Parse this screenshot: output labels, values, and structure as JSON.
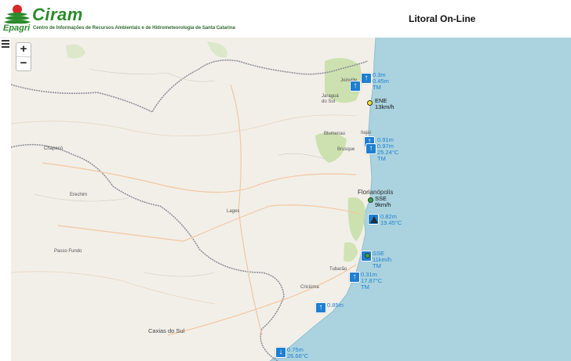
{
  "header": {
    "logo_agency": "Epagri",
    "logo_name": "Ciram",
    "logo_subtitle": "Centro de Informações de Recursos Ambientais e de Hidrometeorologia de Santa Catarina",
    "title": "Litoral On-Line"
  },
  "controls": {
    "menu_icon": "hamburger-icon",
    "zoom_in_label": "+",
    "zoom_out_label": "−"
  },
  "colors": {
    "sea": "#aad3df",
    "land": "#f2efe9",
    "forest": "#c8dfa8",
    "marker": "#1f7fd0"
  },
  "cities": {
    "joinville": "Joinville",
    "jaragua": "Jaraguá do Sul",
    "blumenau": "Blumenau",
    "itajai": "Itajaí",
    "brusque": "Brusque",
    "chapeco": "Chapecó",
    "florianopolis": "Florianópolis",
    "erechim": "Erechim",
    "lages": "Lages",
    "passo_fundo": "Passo Fundo",
    "tubarao": "Tubarão",
    "criciuma": "Criciúma",
    "caxias": "Caxias do Sul"
  },
  "stations": {
    "s1": {
      "l1": "0.3m",
      "l2": "0.45m",
      "l3": "TM",
      "icon": "arrow-up-icon"
    },
    "s2": {
      "l1": "ENE",
      "l2": "13km/h",
      "icon": "wind-dot-icon"
    },
    "s3": {
      "l1": "0.91m",
      "l2": "0.97m",
      "l3": "25.24°C",
      "l4": "TM",
      "icon": "arrow-up-icon"
    },
    "s4": {
      "l1": "SSE",
      "l2": "9km/h",
      "icon": "wind-dot-icon"
    },
    "s5": {
      "l1": "0.82m",
      "l2": "19.45°C",
      "icon": "triangle-icon"
    },
    "s6": {
      "l1": "SSE",
      "l2": "11km/h",
      "l3": "TM",
      "icon": "arrow-up-icon"
    },
    "s7": {
      "l1": "0.31m",
      "l2": "17.87°C",
      "l3": "TM",
      "icon": "arrow-up-icon"
    },
    "s8": {
      "l1": "0.85m",
      "icon": "arrow-up-icon"
    },
    "s9": {
      "l1": "0.75m",
      "l2": "26.66°C",
      "icon": "arrow-down-icon"
    }
  }
}
